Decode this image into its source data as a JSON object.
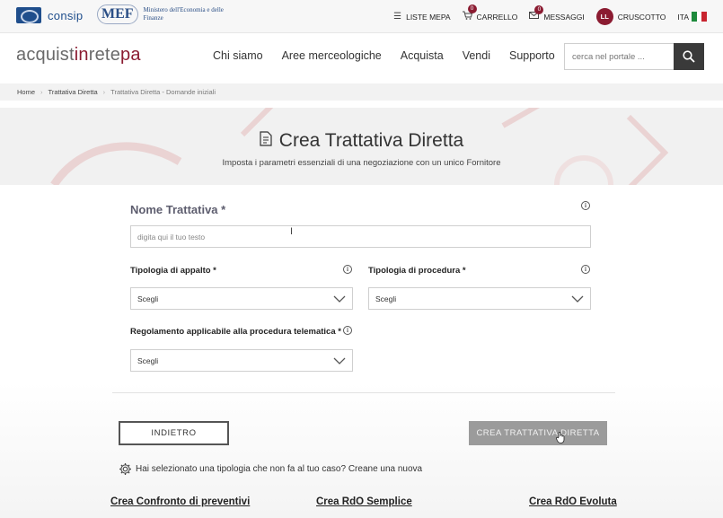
{
  "topbar": {
    "consip_label": "consip",
    "mef_mark": "MEF",
    "mef_text": "Ministero dell'Economia e delle Finanze",
    "liste_mepa": "LISTE MEPA",
    "carrello": "CARRELLO",
    "carrello_count": "0",
    "messaggi": "MESSAGGI",
    "messaggi_count": "0",
    "avatar_initials": "LL",
    "cruscotto": "CRUSCOTTO",
    "language": "ITA"
  },
  "header": {
    "brand_1": "acquist",
    "brand_2": "in",
    "brand_3": "rete",
    "brand_4": "pa",
    "nav": [
      "Chi siamo",
      "Aree merceologiche",
      "Acquista",
      "Vendi",
      "Supporto"
    ],
    "search_placeholder": "cerca nel portale ..."
  },
  "breadcrumb": [
    "Home",
    "Trattativa Diretta",
    "Trattativa Diretta - Domande iniziali"
  ],
  "hero": {
    "title": "Crea Trattativa Diretta",
    "subtitle": "Imposta i parametri essenziali di una negoziazione con un unico Fornitore"
  },
  "form": {
    "nome_label": "Nome Trattativa *",
    "nome_placeholder": "digita qui il tuo testo",
    "tipologia_appalto_label": "Tipologia di appalto *",
    "tipologia_appalto_value": "Scegli",
    "tipologia_procedura_label": "Tipologia di procedura *",
    "tipologia_procedura_value": "Scegli",
    "regolamento_label": "Regolamento applicabile alla procedura telematica *",
    "regolamento_value": "Scegli"
  },
  "actions": {
    "back": "INDIETRO",
    "create": "CREA TRATTATIVA DIRETTA",
    "hint": "Hai selezionato una tipologia che non fa al tuo caso? Creane una nuova",
    "links": [
      "Crea Confronto di preventivi",
      "Crea RdO Semplice",
      "Crea RdO Evoluta"
    ]
  },
  "colors": {
    "brand": "#8b1b31",
    "navy": "#1f4e8c",
    "disabled_button": "#9b9b9b"
  }
}
